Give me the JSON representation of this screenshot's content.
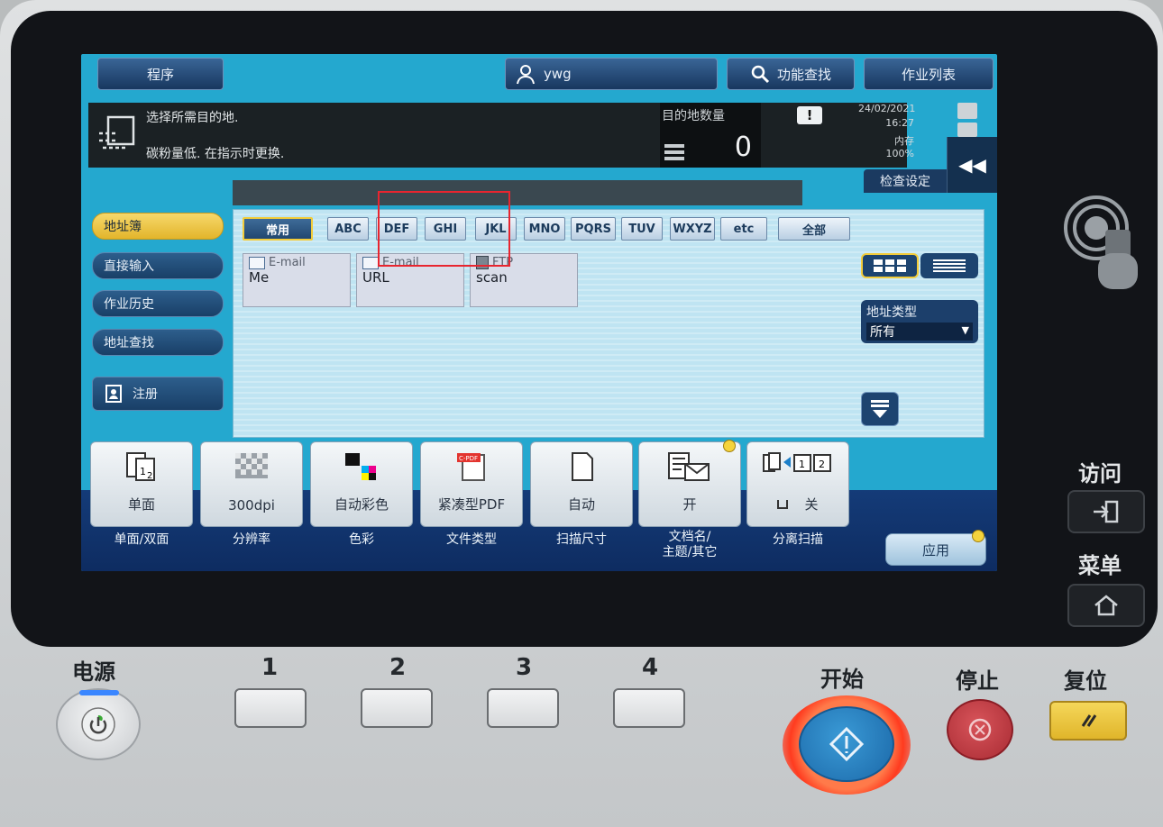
{
  "header": {
    "program": "程序",
    "user": "ywg",
    "function_search": "功能查找",
    "job_list": "作业列表"
  },
  "status": {
    "message_1": "选择所需目的地.",
    "message_2": "碳粉量低. 在指示时更换.",
    "dest_count_label": "目的地数量",
    "dest_count": "0",
    "date": "24/02/2021",
    "time": "16:27",
    "memory_label": "内存",
    "memory_value": "100%",
    "check_settings": "检查设定"
  },
  "left_nav": {
    "address_book": "地址簿",
    "direct_input": "直接输入",
    "job_history": "作业历史",
    "address_search": "地址查找",
    "register": "注册"
  },
  "tabs": [
    "常用",
    "ABC",
    "DEF",
    "GHI",
    "JKL",
    "MNO",
    "PQRS",
    "TUV",
    "WXYZ",
    "etc",
    "全部"
  ],
  "entries": [
    {
      "type": "E-mail",
      "name": "Me"
    },
    {
      "type": "E-mail",
      "name": "URL"
    },
    {
      "type": "FTP",
      "name": "scan"
    }
  ],
  "address_type": {
    "label": "地址类型",
    "selected": "所有"
  },
  "functions": [
    {
      "value": "单面",
      "label": "单面/双面"
    },
    {
      "value": "300dpi",
      "label": "分辨率"
    },
    {
      "value": "自动彩色",
      "label": "色彩"
    },
    {
      "value": "紧凑型PDF",
      "label": "文件类型"
    },
    {
      "value": "自动",
      "label": "扫描尺寸"
    },
    {
      "value": "开",
      "label": "文档名/\n主题/其它"
    },
    {
      "value": "关",
      "label": "分离扫描"
    }
  ],
  "apply": "应用",
  "hardware": {
    "power": "电源",
    "keys": [
      "1",
      "2",
      "3",
      "4"
    ],
    "start": "开始",
    "stop": "停止",
    "reset": "复位",
    "access": "访问",
    "menu": "菜单"
  },
  "colors": {
    "screen_bg": "#24a8cf",
    "highlight": "#e8252f",
    "start_glow": "#ff3b1f"
  }
}
